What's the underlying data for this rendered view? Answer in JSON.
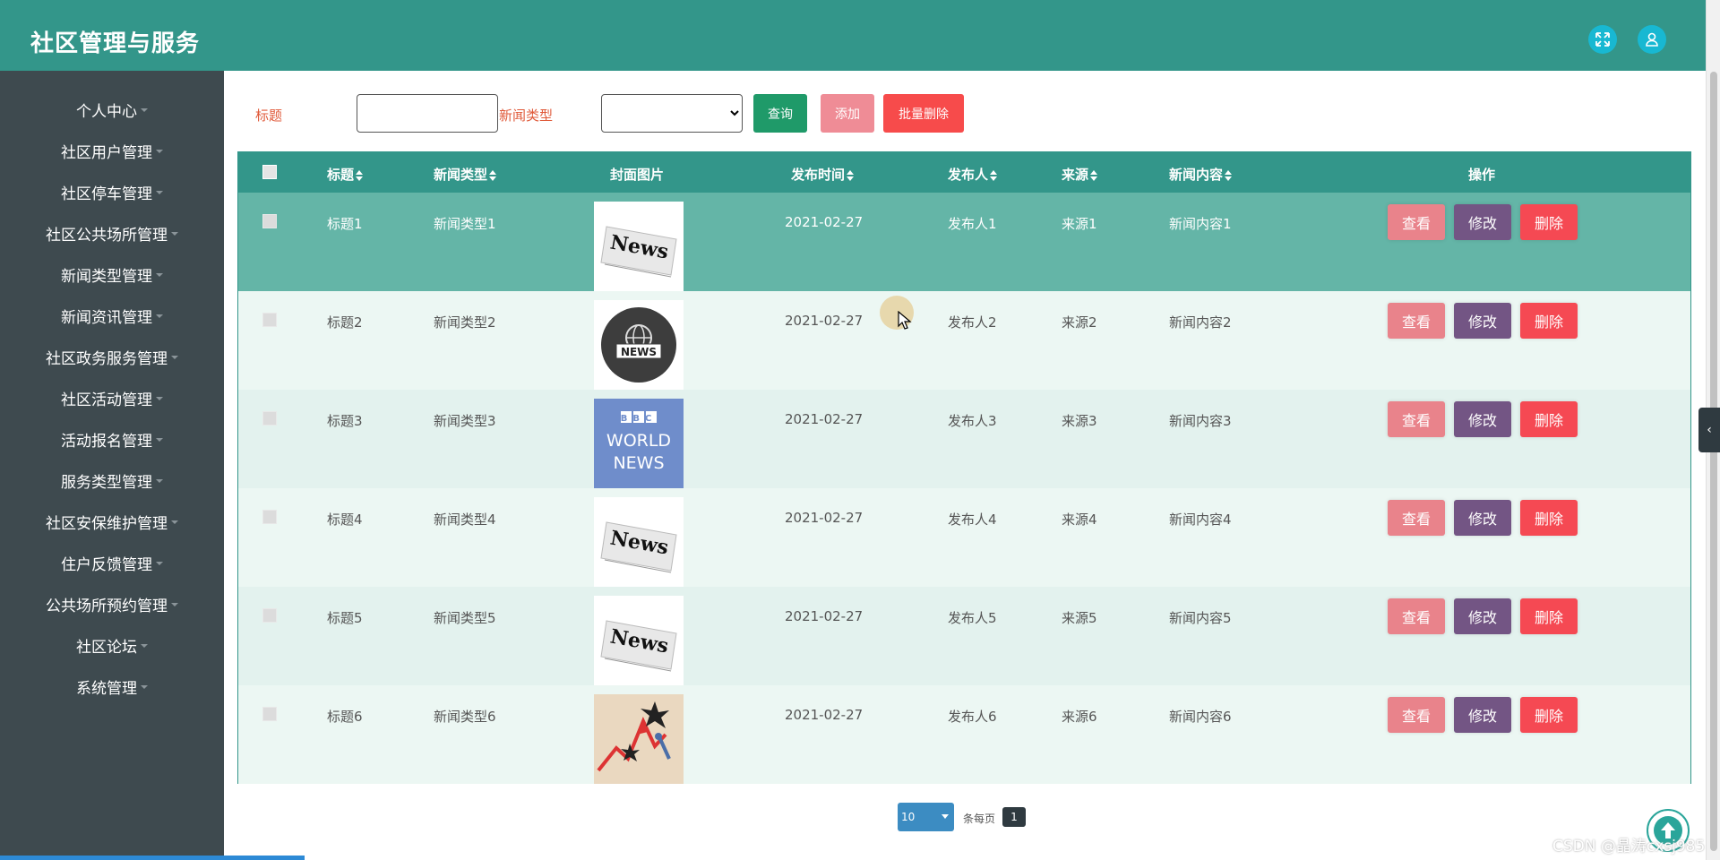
{
  "app": {
    "title": "社区管理与服务"
  },
  "header": {
    "fullscreen_icon": "expand-icon",
    "user_icon": "user-icon"
  },
  "sidebar": {
    "items": [
      {
        "label": "个人中心"
      },
      {
        "label": "社区用户管理"
      },
      {
        "label": "社区停车管理"
      },
      {
        "label": "社区公共场所管理"
      },
      {
        "label": "新闻类型管理"
      },
      {
        "label": "新闻资讯管理"
      },
      {
        "label": "社区政务服务管理"
      },
      {
        "label": "社区活动管理"
      },
      {
        "label": "活动报名管理"
      },
      {
        "label": "服务类型管理"
      },
      {
        "label": "社区安保维护管理"
      },
      {
        "label": "住户反馈管理"
      },
      {
        "label": "公共场所预约管理"
      },
      {
        "label": "社区论坛"
      },
      {
        "label": "系统管理"
      }
    ]
  },
  "search": {
    "title_label": "标题",
    "title_value": "",
    "type_label": "新闻类型",
    "type_value": "",
    "query_button": "查询",
    "add_button": "添加",
    "batch_delete_button": "批量删除"
  },
  "table": {
    "headers": {
      "title": "标题",
      "type": "新闻类型",
      "cover": "封面图片",
      "time": "发布时间",
      "publisher": "发布人",
      "source": "来源",
      "content": "新闻内容",
      "actions": "操作"
    },
    "rows": [
      {
        "title": "标题1",
        "type": "新闻类型1",
        "time": "2021-02-27",
        "publisher": "发布人1",
        "source": "来源1",
        "content": "新闻内容1",
        "selected": true
      },
      {
        "title": "标题2",
        "type": "新闻类型2",
        "time": "2021-02-27",
        "publisher": "发布人2",
        "source": "来源2",
        "content": "新闻内容2"
      },
      {
        "title": "标题3",
        "type": "新闻类型3",
        "time": "2021-02-27",
        "publisher": "发布人3",
        "source": "来源3",
        "content": "新闻内容3"
      },
      {
        "title": "标题4",
        "type": "新闻类型4",
        "time": "2021-02-27",
        "publisher": "发布人4",
        "source": "来源4",
        "content": "新闻内容4"
      },
      {
        "title": "标题5",
        "type": "新闻类型5",
        "time": "2021-02-27",
        "publisher": "发布人5",
        "source": "来源5",
        "content": "新闻内容5"
      },
      {
        "title": "标题6",
        "type": "新闻类型6",
        "time": "2021-02-27",
        "publisher": "发布人6",
        "source": "来源6",
        "content": "新闻内容6"
      }
    ],
    "cover_images": {
      "news_paper_text": "News",
      "globe_text": "NEWS",
      "bbc_text": "BBC",
      "world_text": "WORLD",
      "bbc_news_text": "NEWS"
    },
    "action_labels": {
      "view": "查看",
      "edit": "修改",
      "delete": "删除"
    }
  },
  "pagination": {
    "page_size": "10",
    "per_page_label": "条每页",
    "current_page": "1"
  },
  "watermark": "CSDN @晶涛cxsj985",
  "colors": {
    "header": "#33968a",
    "sidebar": "#3e4a4f",
    "view_button": "#e9838b",
    "edit_button": "#735584",
    "delete_button": "#f54953"
  }
}
